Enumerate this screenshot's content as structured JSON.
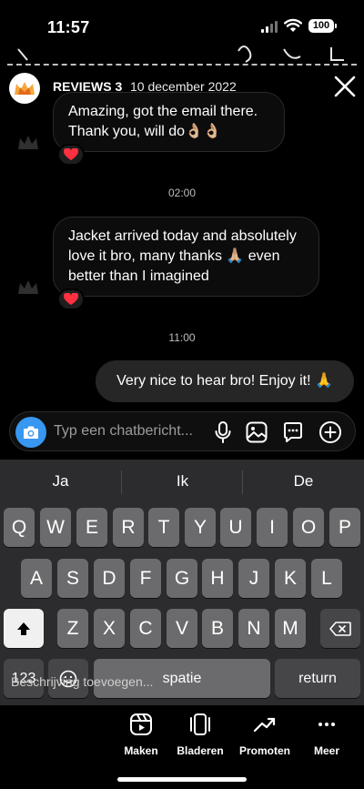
{
  "status_bar": {
    "time": "11:57",
    "battery": "100"
  },
  "story": {
    "name": "REVIEWS 3",
    "date": "10 december 2022"
  },
  "messages": [
    {
      "text": "Amazing, got the email there. Thank you, will do👌🏼👌🏼",
      "reaction": "❤️"
    },
    {
      "timestamp": "02:00"
    },
    {
      "text": "Jacket arrived today and absolutely love it bro, many thanks 🙏🏼 even better than I imagined",
      "reaction": "❤️"
    },
    {
      "timestamp": "11:00"
    },
    {
      "text": "Very nice to hear bro! Enjoy it! 🙏"
    }
  ],
  "composer": {
    "placeholder": "Typ een chatbericht..."
  },
  "keyboard": {
    "suggestions": [
      "Ja",
      "Ik",
      "De"
    ],
    "row1": [
      "Q",
      "W",
      "E",
      "R",
      "T",
      "Y",
      "U",
      "I",
      "O",
      "P"
    ],
    "row2": [
      "A",
      "S",
      "D",
      "F",
      "G",
      "H",
      "J",
      "K",
      "L"
    ],
    "row3": [
      "Z",
      "X",
      "C",
      "V",
      "B",
      "N",
      "M"
    ],
    "numbers_key": "123",
    "space_key": "spatie",
    "return_key": "return",
    "overlay_hint": "Beschrijving toevoegen..."
  },
  "bottom_bar": {
    "items": [
      {
        "label": "Maken",
        "icon": "reels-icon"
      },
      {
        "label": "Bladeren",
        "icon": "carousel-icon"
      },
      {
        "label": "Promoten",
        "icon": "trending-up-icon"
      },
      {
        "label": "Meer",
        "icon": "more-icon"
      }
    ]
  },
  "colors": {
    "accent": "#3897f0",
    "heart": "#ff3040",
    "keyboard_bg": "#2c2c2e",
    "key": "#6b6b6d"
  }
}
